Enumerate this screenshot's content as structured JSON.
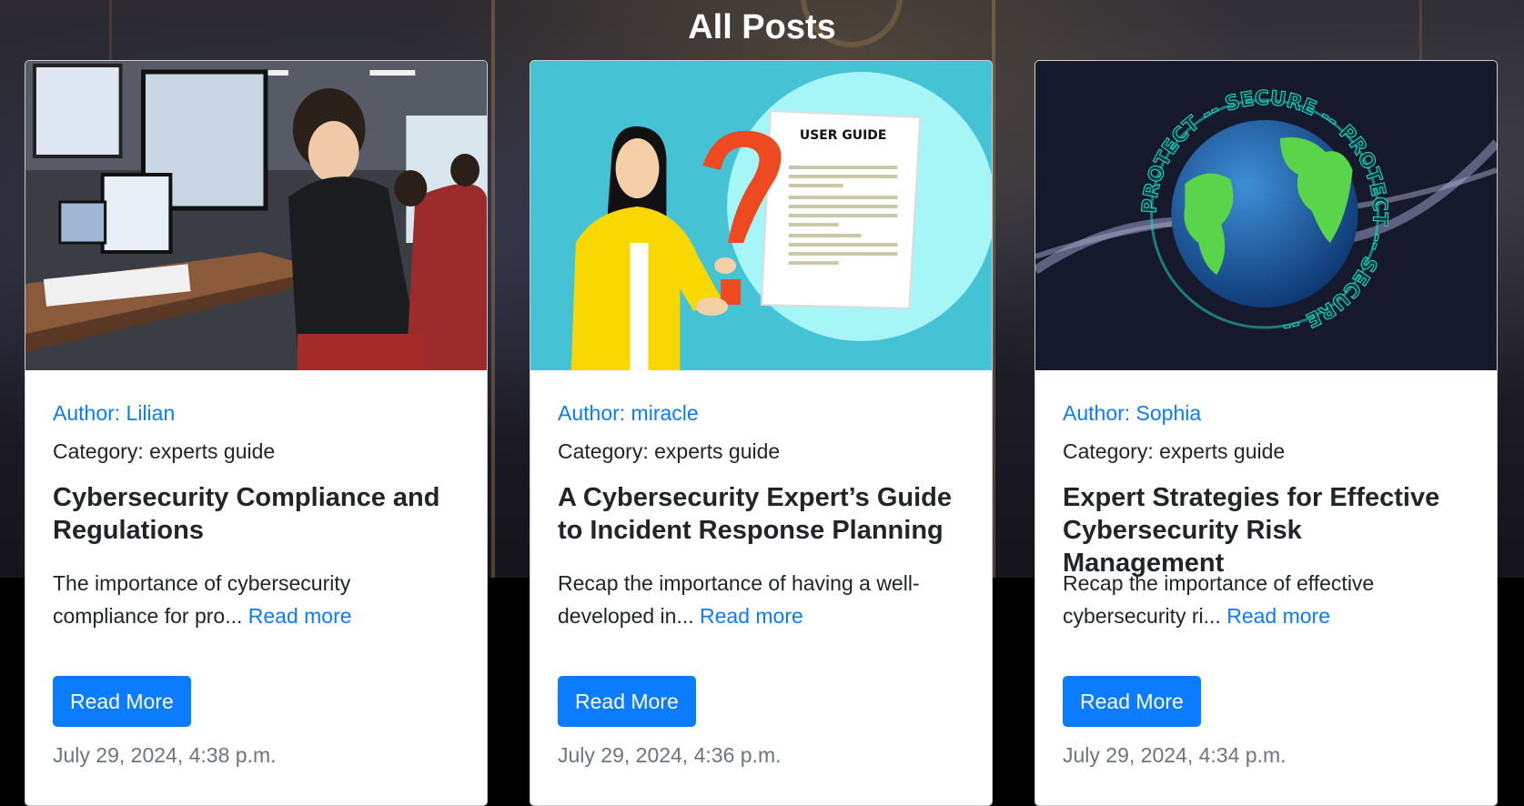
{
  "page": {
    "title": "All Posts"
  },
  "colors": {
    "link": "#0b7bff",
    "button": "#0b7bff",
    "muted": "#6c757d"
  },
  "posts": [
    {
      "image_icon": "programmer-at-computer-image",
      "author": "Author: Lilian",
      "category": "Category: experts guide",
      "title": "Cybersecurity Compliance and Regulations",
      "excerpt": "The importance of cybersecurity compliance for pro...",
      "read_more_link": "Read more",
      "button": "Read More",
      "date": "July 29, 2024, 4:38 p.m."
    },
    {
      "image_icon": "user-guide-illustration-image",
      "image_text": "USER GUIDE",
      "author": "Author: miracle",
      "category": "Category: experts guide",
      "title": "A Cybersecurity Expert’s Guide to Incident Response Planning",
      "excerpt": "Recap the importance of having a well-developed in...",
      "read_more_link": "Read more",
      "button": "Read More",
      "date": "July 29, 2024, 4:36 p.m."
    },
    {
      "image_icon": "globe-protect-secure-image",
      "image_text": "PROTECT -- SECURE -- PROTECT -- SECURE --",
      "author": "Author: Sophia",
      "category": "Category: experts guide",
      "title": "Expert Strategies for Effective Cybersecurity Risk Management",
      "excerpt": "Recap the importance of effective cybersecurity ri...",
      "read_more_link": "Read more",
      "button": "Read More",
      "date": "July 29, 2024, 4:34 p.m."
    }
  ]
}
